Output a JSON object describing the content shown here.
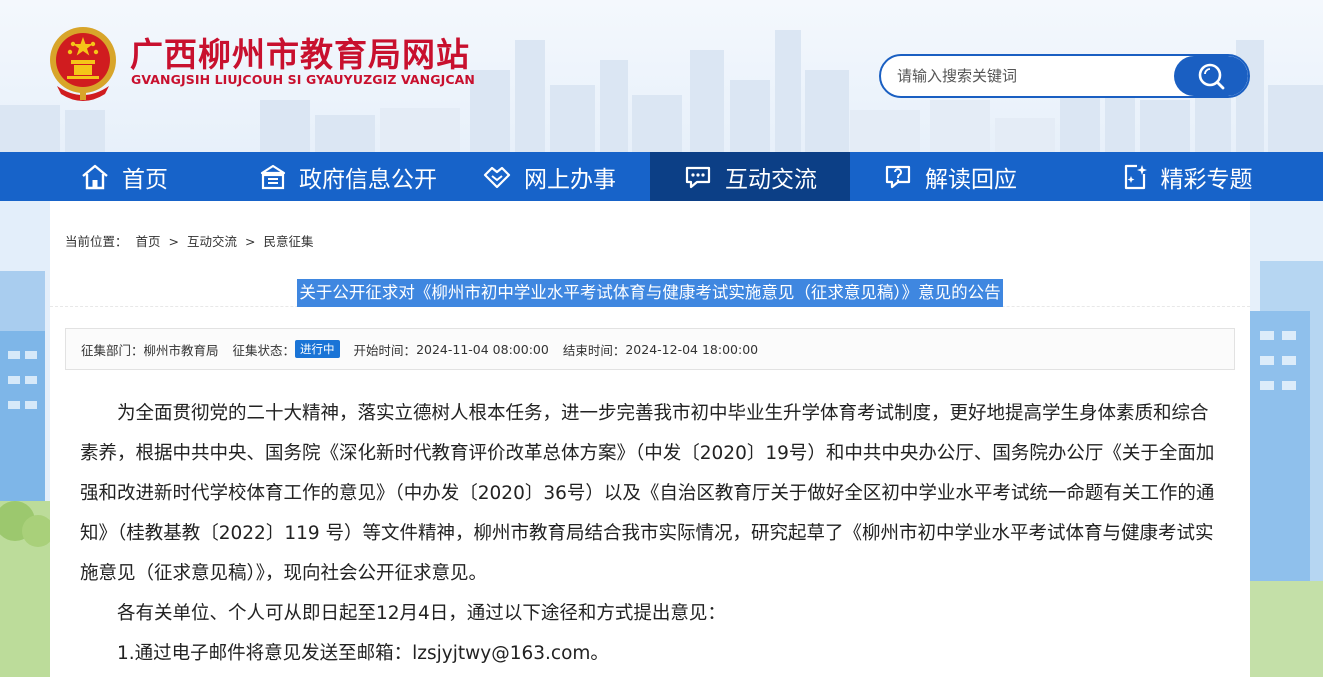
{
  "header": {
    "site_title": "广西柳州市教育局网站",
    "site_subtitle": "GVANGJSIH LIUJCOUH SI GYAUYUZGIZ VANGJCAN",
    "search_placeholder": "请输入搜索关键词"
  },
  "nav": {
    "items": [
      {
        "label": "首页",
        "icon": "home-icon"
      },
      {
        "label": "政府信息公开",
        "icon": "building-icon"
      },
      {
        "label": "网上办事",
        "icon": "handshake-icon"
      },
      {
        "label": "互动交流",
        "icon": "chat-icon",
        "active": true
      },
      {
        "label": "解读回应",
        "icon": "question-chat-icon"
      },
      {
        "label": "精彩专题",
        "icon": "sparkle-doc-icon"
      }
    ]
  },
  "breadcrumb": {
    "prefix": "当前位置：",
    "items": [
      "首页",
      ">",
      "互动交流",
      ">",
      "民意征集"
    ]
  },
  "article": {
    "title": "关于公开征求对《柳州市初中学业水平考试体育与健康考试实施意见（征求意见稿）》意见的公告",
    "meta": {
      "dept_label": "征集部门：",
      "dept_value": "柳州市教育局",
      "status_label": "征集状态：",
      "status_value": "进行中",
      "start_label": "开始时间：",
      "start_value": "2024-11-04 08:00:00",
      "end_label": "结束时间：",
      "end_value": "2024-12-04 18:00:00"
    },
    "paragraphs": [
      "为全面贯彻党的二十大精神，落实立德树人根本任务，进一步完善我市初中毕业生升学体育考试制度，更好地提高学生身体素质和综合素养，根据中共中央、国务院《深化新时代教育评价改革总体方案》（中发〔2020〕19号）和中共中央办公厅、国务院办公厅《关于全面加强和改进新时代学校体育工作的意见》（中办发〔2020〕36号）以及《自治区教育厅关于做好全区初中学业水平考试统一命题有关工作的通知》（桂教基教〔2022〕119 号）等文件精神，柳州市教育局结合我市实际情况，研究起草了《柳州市初中学业水平考试体育与健康考试实施意见（征求意见稿）》，现向社会公开征求意见。",
      "各有关单位、个人可从即日起至12月4日，通过以下途径和方式提出意见：",
      "1.通过电子邮件将意见发送至邮箱：lzsjyjtwy@163.com。"
    ]
  },
  "colors": {
    "brand_red": "#c8102e",
    "nav_blue": "#1763c9",
    "nav_active": "#0c3f86",
    "title_highlight": "#3f87e0",
    "badge_blue": "#1a74d6"
  }
}
